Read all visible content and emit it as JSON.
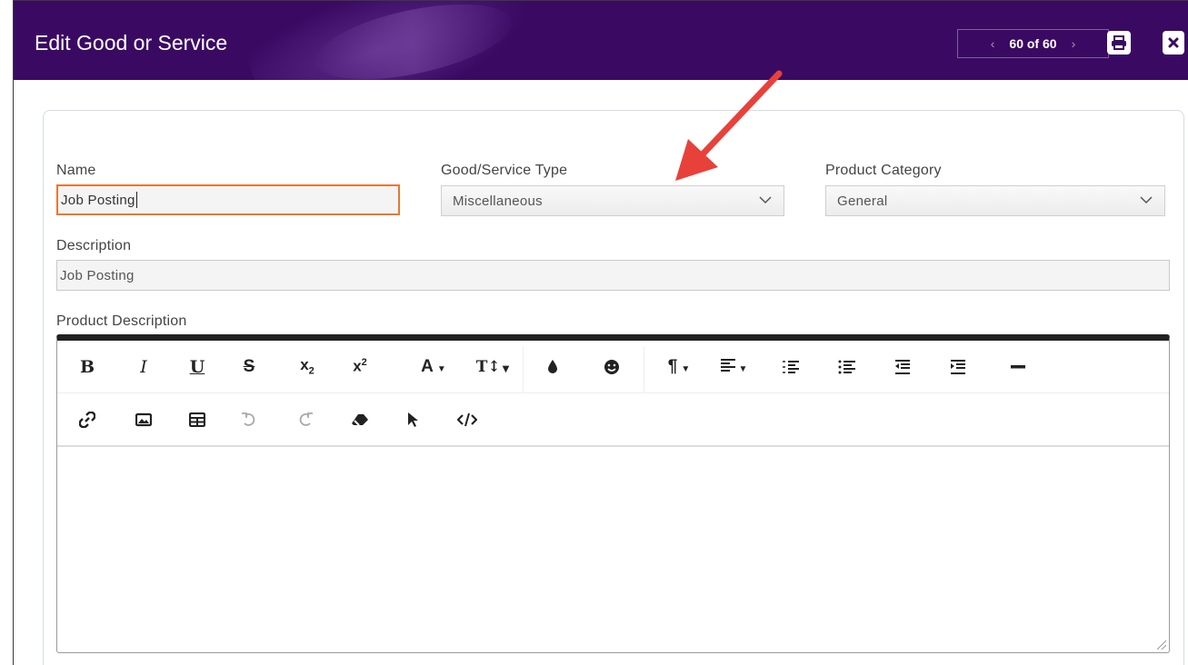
{
  "dialog": {
    "title": "Edit Good or Service",
    "pager": {
      "text": "60 of 60",
      "prev": "‹",
      "next": "›"
    },
    "print_icon": "print-icon",
    "close_icon": "close-icon",
    "header_color": "#3a0a63"
  },
  "form": {
    "name": {
      "label": "Name",
      "value": "Job Posting",
      "focus_color": "#e87734"
    },
    "type": {
      "label": "Good/Service Type",
      "value": "Miscellaneous"
    },
    "category": {
      "label": "Product Category",
      "value": "General"
    },
    "description": {
      "label": "Description",
      "value": "Job Posting"
    },
    "product_description": {
      "label": "Product Description"
    }
  },
  "toolbar": {
    "row1": [
      "bold-icon",
      "italic-icon",
      "underline-icon",
      "strikethrough-icon",
      "subscript-icon",
      "superscript-icon",
      "font-color-icon",
      "font-size-icon",
      "color-drop-icon",
      "emoji-icon",
      "paragraph-format-icon",
      "align-icon",
      "ordered-list-icon",
      "unordered-list-icon",
      "outdent-icon",
      "indent-icon",
      "horizontal-line-icon"
    ],
    "row2": [
      "link-icon",
      "image-icon",
      "table-icon",
      "undo-icon",
      "redo-icon",
      "clear-format-icon",
      "select-all-icon",
      "code-view-icon"
    ]
  },
  "annotation": {
    "arrow_color": "#e8413a"
  }
}
